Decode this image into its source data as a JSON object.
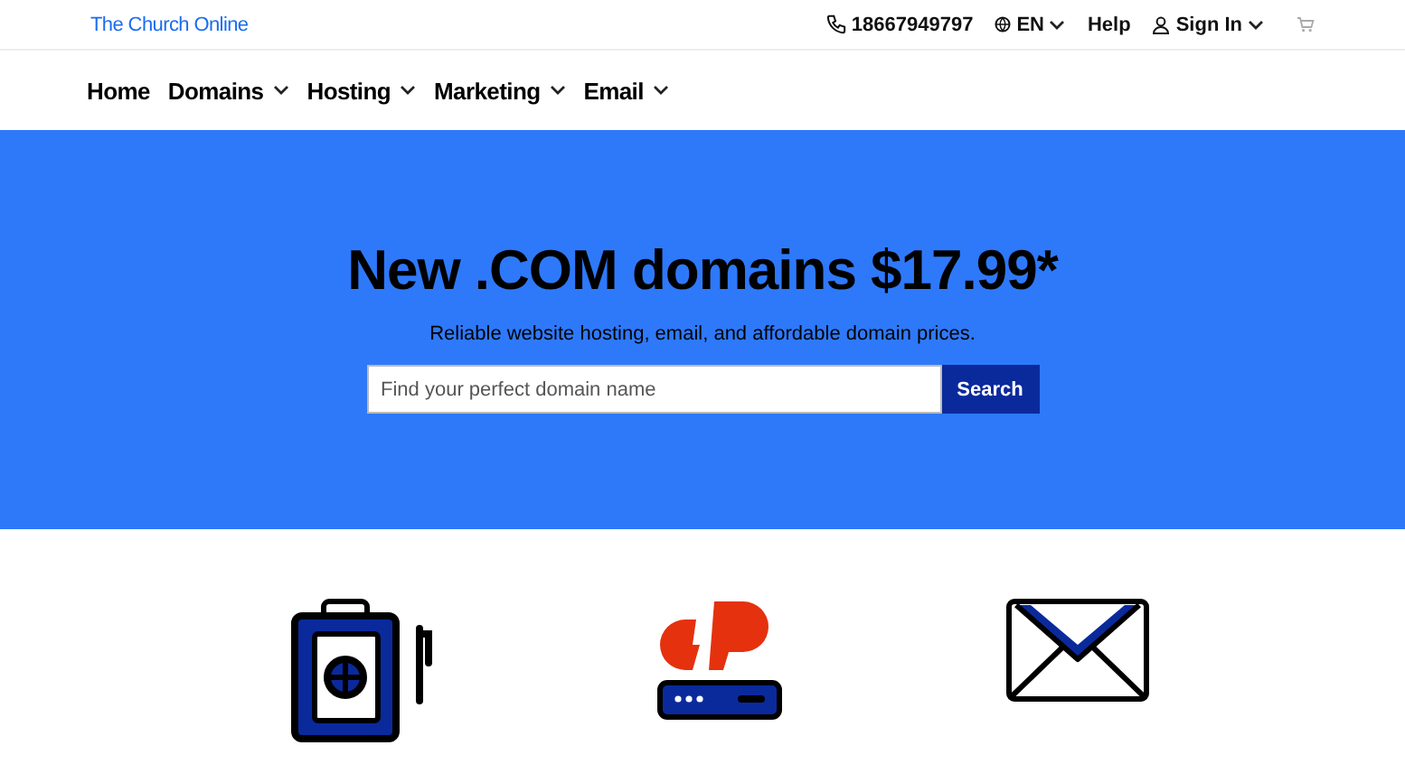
{
  "topbar": {
    "brand": "The Church Online",
    "phone": "18667949797",
    "language": "EN",
    "help": "Help",
    "sign_in": "Sign In"
  },
  "nav": [
    {
      "label": "Home",
      "dropdown": false
    },
    {
      "label": "Domains",
      "dropdown": true
    },
    {
      "label": "Hosting",
      "dropdown": true
    },
    {
      "label": "Marketing",
      "dropdown": true
    },
    {
      "label": "Email",
      "dropdown": true
    }
  ],
  "hero": {
    "title": "New .COM domains $17.99*",
    "subtitle": "Reliable website hosting, email, and affordable domain prices.",
    "search": {
      "placeholder": "Find your perfect domain name",
      "button": "Search"
    }
  },
  "features": [
    {
      "kind": "builder"
    },
    {
      "kind": "panel"
    },
    {
      "kind": "email"
    }
  ]
}
